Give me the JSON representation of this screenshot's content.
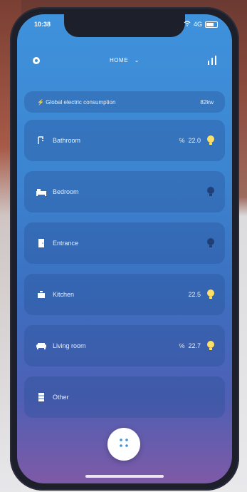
{
  "status_bar": {
    "time": "10:38",
    "signal": "4G"
  },
  "app_bar": {
    "home_label": "HOME",
    "chevron": "⌄"
  },
  "global": {
    "label": "Global electric consumption",
    "value": "82kw"
  },
  "rooms": [
    {
      "name": "Bathroom",
      "temp_prefix": "℅",
      "temp": "22.0",
      "light": "on",
      "icon": "shower-icon"
    },
    {
      "name": "Bedroom",
      "temp_prefix": "",
      "temp": "",
      "light": "off",
      "icon": "bed-icon"
    },
    {
      "name": "Entrance",
      "temp_prefix": "",
      "temp": "",
      "light": "off",
      "icon": "door-icon"
    },
    {
      "name": "Kitchen",
      "temp_prefix": "",
      "temp": "22.5",
      "light": "on",
      "icon": "pot-icon"
    },
    {
      "name": "Living room",
      "temp_prefix": "℅",
      "temp": "22.7",
      "light": "on",
      "icon": "sofa-icon"
    },
    {
      "name": "Other",
      "temp_prefix": "",
      "temp": "",
      "light": "none",
      "icon": "cabinet-icon"
    }
  ],
  "colors": {
    "bulb_on": "#ffe066",
    "bulb_off": "#1f3f78",
    "accent": "#3f92dc"
  }
}
